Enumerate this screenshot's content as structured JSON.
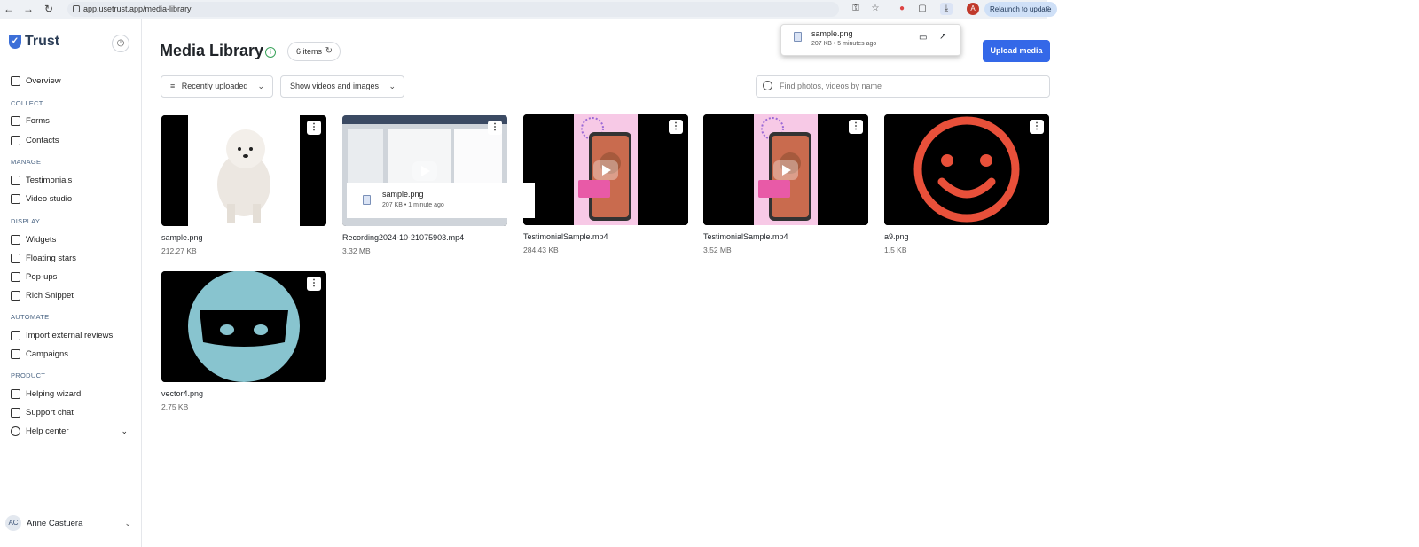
{
  "browser": {
    "url": "app.usetrust.app/media-library",
    "relaunch_label": "Relaunch to update",
    "profile_initial": "A"
  },
  "sidebar": {
    "brand": "Trust",
    "items": [
      {
        "section": "",
        "label": "Overview",
        "icon": "home-icon"
      },
      {
        "section": "COLLECT",
        "label": "Forms",
        "icon": "form-icon"
      },
      {
        "section": "",
        "label": "Contacts",
        "icon": "contact-icon"
      },
      {
        "section": "MANAGE",
        "label": "Testimonials",
        "icon": "thumbs-up-icon"
      },
      {
        "section": "",
        "label": "Video studio",
        "icon": "video-icon"
      },
      {
        "section": "DISPLAY",
        "label": "Widgets",
        "icon": "widget-icon"
      },
      {
        "section": "",
        "label": "Floating stars",
        "icon": "sparkle-icon"
      },
      {
        "section": "",
        "label": "Pop-ups",
        "icon": "popup-icon"
      },
      {
        "section": "",
        "label": "Rich Snippet",
        "icon": "globe-icon"
      },
      {
        "section": "AUTOMATE",
        "label": "Import external reviews",
        "icon": "share-icon"
      },
      {
        "section": "",
        "label": "Campaigns",
        "icon": "mail-icon"
      },
      {
        "section": "PRODUCT",
        "label": "Helping wizard",
        "icon": "bolt-icon"
      },
      {
        "section": "",
        "label": "Support chat",
        "icon": "chat-icon"
      },
      {
        "section": "",
        "label": "Help center",
        "icon": "lifebuoy-icon"
      }
    ],
    "sections": [
      "COLLECT",
      "MANAGE",
      "DISPLAY",
      "AUTOMATE",
      "PRODUCT"
    ],
    "user": {
      "initials": "AC",
      "name": "Anne Castuera"
    }
  },
  "header": {
    "title": "Media Library",
    "count": "6 items",
    "upload_label": "Upload media"
  },
  "filters": {
    "sort": "Recently uploaded",
    "type": "Show videos and images",
    "search_placeholder": "Find photos, videos by name"
  },
  "media": [
    {
      "name": "sample.png",
      "size": "212.27 KB",
      "kind": "image",
      "thumb": "dog"
    },
    {
      "name": "Recording2024-10-21075903.mp4",
      "size": "3.32 MB",
      "kind": "video",
      "thumb": "screen"
    },
    {
      "name": "TestimonialSample.mp4",
      "size": "284.43 KB",
      "kind": "video",
      "thumb": "phone"
    },
    {
      "name": "TestimonialSample.mp4",
      "size": "3.52 MB",
      "kind": "video",
      "thumb": "phone"
    },
    {
      "name": "a9.png",
      "size": "1.5 KB",
      "kind": "image",
      "thumb": "smiley"
    },
    {
      "name": "vector4.png",
      "size": "2.75 KB",
      "kind": "image",
      "thumb": "ninja"
    }
  ],
  "download_popup": {
    "name": "sample.png",
    "meta": "207 KB • 5 minutes ago"
  },
  "drag_ghost": {
    "name": "sample.png",
    "meta": "207 KB • 1 minute ago"
  },
  "colors": {
    "accent": "#3468e8",
    "smiley": "#e8503a",
    "ninja": "#88c4cf",
    "phone_bg": "#f7c9e6"
  }
}
